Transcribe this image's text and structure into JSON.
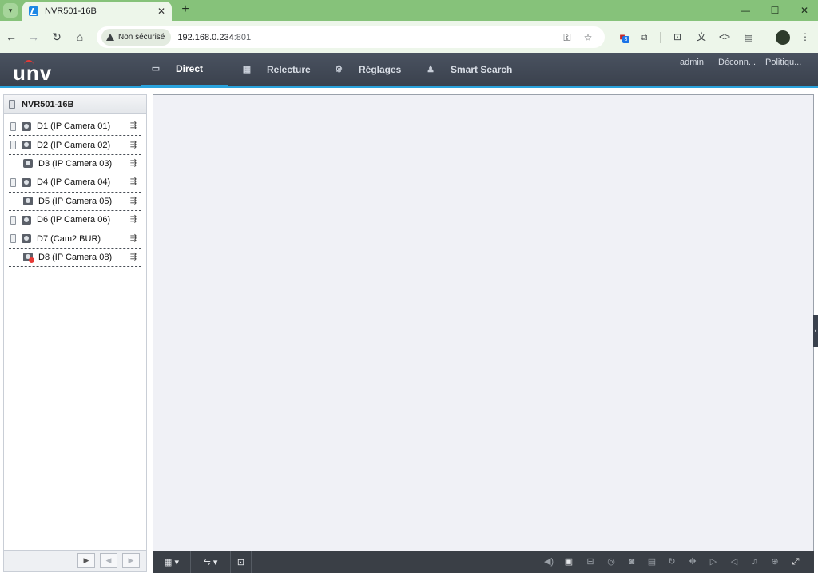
{
  "browser": {
    "tab_title": "NVR501-16B",
    "security_label": "Non sécurisé",
    "url_host": "192.168.0.234",
    "url_port": ":801",
    "extension_badge": "3"
  },
  "app": {
    "logo": "unv",
    "nav": [
      {
        "label": "Direct",
        "active": true
      },
      {
        "label": "Relecture",
        "active": false
      },
      {
        "label": "Réglages",
        "active": false
      },
      {
        "label": "Smart Search",
        "active": false
      }
    ],
    "user_links": {
      "user": "admin",
      "logout": "Déconn...",
      "policy": "Politiqu..."
    }
  },
  "sidebar": {
    "device_name": "NVR501-16B",
    "cameras": [
      {
        "label": "D1 (IP Camera 01)",
        "recording": true,
        "online": true
      },
      {
        "label": "D2 (IP Camera 02)",
        "recording": true,
        "online": true
      },
      {
        "label": "D3 (IP Camera 03)",
        "recording": false,
        "online": true
      },
      {
        "label": "D4 (IP Camera 04)",
        "recording": true,
        "online": true
      },
      {
        "label": "D5 (IP Camera 05)",
        "recording": false,
        "online": true
      },
      {
        "label": "D6 (IP Camera 06)",
        "recording": true,
        "online": true
      },
      {
        "label": "D7 (Cam2 BUR)",
        "recording": true,
        "online": true
      },
      {
        "label": "D8 (IP Camera 08)",
        "recording": false,
        "online": false
      }
    ]
  },
  "colors": {
    "accent": "#2aa3dd",
    "header_bg": "#3a414d",
    "browser_frame": "#86c27a",
    "offline": "#e53935"
  }
}
